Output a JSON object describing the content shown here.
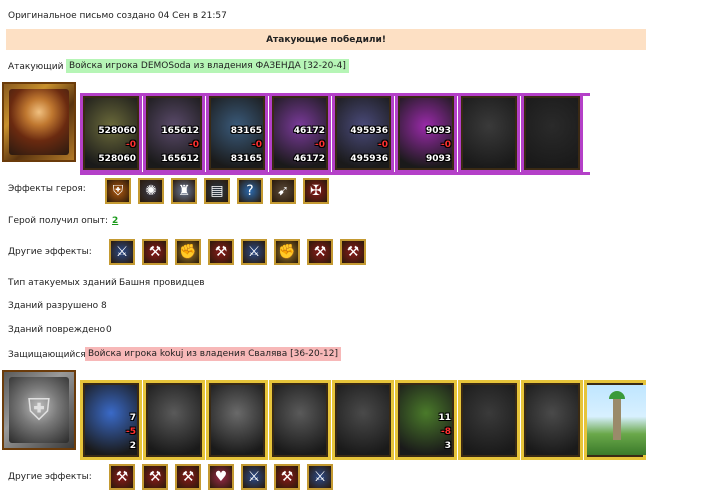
{
  "header": {
    "original_note": "Оригинальное письмо создано 04 Сен в 21:57"
  },
  "banner": {
    "result": "Атакующие победили!"
  },
  "attacker": {
    "label": "Атакующий",
    "army": "Войска игрока DEMOSoda из владения ФАЗЕНДА [32-20-4]",
    "units": [
      {
        "count": "528060",
        "loss": "-0",
        "remain": "528060",
        "color": "#6b6a3a"
      },
      {
        "count": "165612",
        "loss": "-0",
        "remain": "165612",
        "color": "#5a4a6a"
      },
      {
        "count": "83165",
        "loss": "-0",
        "remain": "83165",
        "color": "#3a5a7a"
      },
      {
        "count": "46172",
        "loss": "-0",
        "remain": "46172",
        "color": "#7a3a9a"
      },
      {
        "count": "495936",
        "loss": "-0",
        "remain": "495936",
        "color": "#4a4a7a"
      },
      {
        "count": "9093",
        "loss": "-0",
        "remain": "9093",
        "color": "#9a2aaa"
      },
      {
        "count": "",
        "loss": "",
        "remain": "",
        "color": "#3a3a3a"
      },
      {
        "count": "",
        "loss": "",
        "remain": "",
        "color": "#2a2a2a"
      }
    ],
    "hero_effects_label": "Эффекты героя:",
    "hero_effects": [
      {
        "icon": "shield-icon",
        "glyph": "⛨",
        "bg": "#b05a10"
      },
      {
        "icon": "claw-icon",
        "glyph": "✺",
        "bg": "#3a3a4a"
      },
      {
        "icon": "castle-icon",
        "glyph": "♜",
        "bg": "#6a7a9a"
      },
      {
        "icon": "barrel-icon",
        "glyph": "▤",
        "bg": "#2a3a4a"
      },
      {
        "icon": "question-icon",
        "glyph": "?",
        "bg": "#2a6ab0"
      },
      {
        "icon": "spear-icon",
        "glyph": "➹",
        "bg": "#5a4a3a"
      },
      {
        "icon": "crest-icon",
        "glyph": "✠",
        "bg": "#8a1a1a"
      }
    ],
    "exp_label": "Герой получил опыт:",
    "exp_value": "2",
    "other_effects_label": "Другие эффекты:",
    "other_effects": [
      {
        "icon": "sword-icon",
        "glyph": "⚔",
        "bg": "#2a4a8a"
      },
      {
        "icon": "axe-icon",
        "glyph": "⚒",
        "bg": "#8a1a1a"
      },
      {
        "icon": "fist-icon",
        "glyph": "✊",
        "bg": "#9a7a2a"
      },
      {
        "icon": "axe-icon",
        "glyph": "⚒",
        "bg": "#8a1a1a"
      },
      {
        "icon": "sword-icon",
        "glyph": "⚔",
        "bg": "#2a4a8a"
      },
      {
        "icon": "fist-icon",
        "glyph": "✊",
        "bg": "#9a7a2a"
      },
      {
        "icon": "axe-icon",
        "glyph": "⚒",
        "bg": "#8a1a1a"
      },
      {
        "icon": "axe-icon",
        "glyph": "⚒",
        "bg": "#8a1a1a"
      }
    ]
  },
  "buildings": {
    "type_label": "Тип атакуемых зданий",
    "type_value": "Башня провидцев",
    "destroyed_label": "Зданий разрушено",
    "destroyed_value": "8",
    "damaged_label": "Зданий повреждено",
    "damaged_value": "0"
  },
  "defender": {
    "label": "Защищающийся",
    "army": "Войска игрока kokuj из владения Свалява [36-20-12]",
    "units": [
      {
        "count": "7",
        "loss": "-5",
        "remain": "2",
        "color": "#3a6ac8"
      },
      {
        "count": "",
        "loss": "",
        "remain": "",
        "color": "#5a5a5a"
      },
      {
        "count": "",
        "loss": "",
        "remain": "",
        "color": "#6a6a6a"
      },
      {
        "count": "",
        "loss": "",
        "remain": "",
        "color": "#5a5a5a"
      },
      {
        "count": "",
        "loss": "",
        "remain": "",
        "color": "#4a4a4a"
      },
      {
        "count": "11",
        "loss": "-8",
        "remain": "3",
        "color": "#4a7a2a"
      },
      {
        "count": "",
        "loss": "",
        "remain": "",
        "color": "#3a3a3a"
      },
      {
        "count": "",
        "loss": "",
        "remain": "",
        "color": "#4a4a4a"
      },
      {
        "count": "",
        "loss": "",
        "remain": "",
        "color": "#5a5a5a"
      }
    ],
    "other_effects_label": "Другие эффекты:",
    "other_effects": [
      {
        "icon": "axe-icon",
        "glyph": "⚒",
        "bg": "#8a1a1a"
      },
      {
        "icon": "axe-icon",
        "glyph": "⚒",
        "bg": "#8a1a1a"
      },
      {
        "icon": "axe-icon",
        "glyph": "⚒",
        "bg": "#8a1a1a"
      },
      {
        "icon": "heart-icon",
        "glyph": "♥",
        "bg": "#9a2a4a"
      },
      {
        "icon": "sword-icon",
        "glyph": "⚔",
        "bg": "#2a4a8a"
      },
      {
        "icon": "axe-icon",
        "glyph": "⚒",
        "bg": "#8a1a1a"
      },
      {
        "icon": "sword-icon",
        "glyph": "⚔",
        "bg": "#2a4a8a"
      }
    ]
  }
}
